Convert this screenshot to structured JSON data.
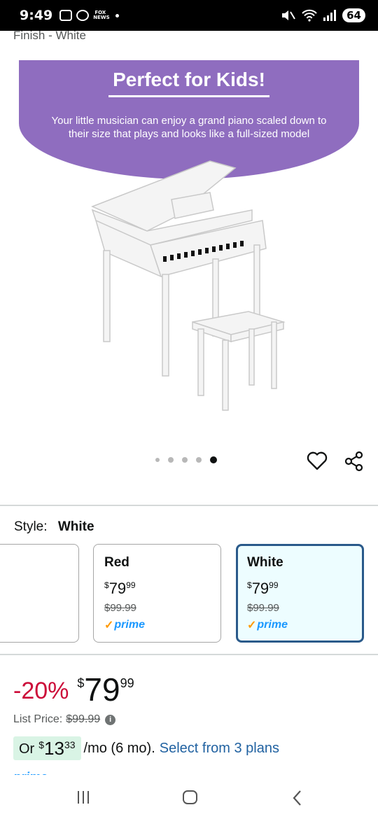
{
  "status_bar": {
    "time": "9:49",
    "battery": "64"
  },
  "product": {
    "finish_text": "Finish - White"
  },
  "hero": {
    "banner_title": "Perfect for Kids!",
    "banner_subtitle": "Your little musician can enjoy a grand piano scaled down to their size that plays and looks like a full-sized model",
    "banner_color": "#8f6dbf",
    "dots_total": 5,
    "dots_active_index": 4
  },
  "style_selector": {
    "label": "Style:",
    "selected_value": "White",
    "options": [
      {
        "name": "",
        "price_symbol": "",
        "price_whole": "",
        "price_fraction": "",
        "list_price": "",
        "prime": ""
      },
      {
        "name": "Red",
        "price_symbol": "$",
        "price_whole": "79",
        "price_fraction": "99",
        "list_price": "$99.99",
        "prime": "prime"
      },
      {
        "name": "White",
        "price_symbol": "$",
        "price_whole": "79",
        "price_fraction": "99",
        "list_price": "$99.99",
        "prime": "prime"
      }
    ]
  },
  "pricing": {
    "discount": "-20%",
    "price_symbol": "$",
    "price_whole": "79",
    "price_fraction": "99",
    "list_price_label": "List Price:",
    "list_price": "$99.99",
    "monthly_prefix": "Or",
    "monthly_symbol": "$",
    "monthly_whole": "13",
    "monthly_fraction": "33",
    "monthly_suffix": "/mo (6 mo).",
    "plans_link": "Select from 3 plans",
    "prime_peek": "prime"
  },
  "colors": {
    "discount": "#cc0c39",
    "link": "#2162a1",
    "selected_border": "#2a5a8a",
    "prime_blue": "#1a98ff"
  }
}
